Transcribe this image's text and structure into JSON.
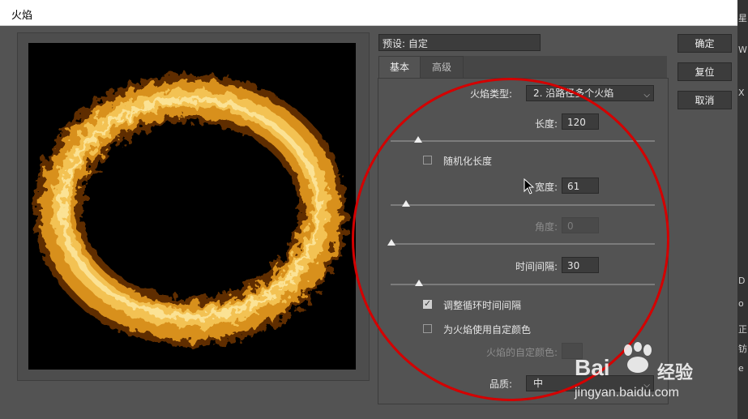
{
  "window": {
    "title": "火焰"
  },
  "right_strip": {
    "chars": [
      "星",
      "W",
      "X",
      "D",
      "o",
      "正",
      "钫",
      "e"
    ]
  },
  "preset": {
    "label": "预设: 自定"
  },
  "tabs": [
    {
      "label": "基本",
      "active": true
    },
    {
      "label": "高级",
      "active": false
    }
  ],
  "controls": {
    "flame_type": {
      "label": "火焰类型:",
      "value": "2. 沿路径多个火焰"
    },
    "length": {
      "label": "长度:",
      "value": "120",
      "slider": 0.1
    },
    "randomize_length": {
      "label": "随机化长度",
      "checked": false
    },
    "width": {
      "label": "宽度:",
      "value": "61",
      "slider": 0.06
    },
    "angle": {
      "label": "角度:",
      "value": "0",
      "slider": 0.0,
      "disabled": true
    },
    "interval": {
      "label": "时间间隔:",
      "value": "30",
      "slider": 0.1
    },
    "adjust_loop": {
      "label": "调整循环时间间隔",
      "checked": true
    },
    "custom_color": {
      "label": "为火焰使用自定颜色",
      "checked": false
    },
    "custom_color_swatch": {
      "label": "火焰的自定颜色:",
      "disabled": true
    },
    "quality": {
      "label": "品质:",
      "value": "中"
    }
  },
  "buttons": {
    "ok": "确定",
    "reset": "复位",
    "cancel": "取消"
  },
  "watermark": {
    "brand": "Bai",
    "cn": "经验",
    "url": "jingyan.baidu.com"
  },
  "colors": {
    "annotation": "#d40000",
    "flame": "#f0b03a"
  }
}
